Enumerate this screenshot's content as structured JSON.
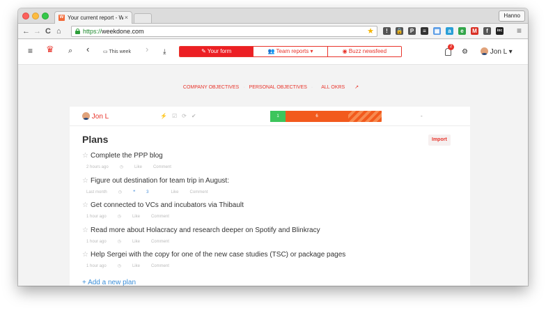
{
  "browser": {
    "tab_title": "Your current report - Weekdone",
    "tab_close": "×",
    "tab_favicon": "W",
    "profile": "Hanno",
    "url_scheme": "https://",
    "url_host": "weekdone.com",
    "nav": {
      "back": "←",
      "forward": "→",
      "reload": "C",
      "home": "⌂"
    },
    "bookmark_star": "★",
    "extensions": [
      {
        "icon": "info-icon",
        "glyph": "!",
        "color": "#555555"
      },
      {
        "icon": "lock-icon",
        "glyph": "🔒",
        "color": "#555555"
      },
      {
        "icon": "pocket-icon",
        "glyph": "P",
        "color": "#555555"
      },
      {
        "icon": "buffer-icon",
        "glyph": "≡",
        "color": "#333333"
      },
      {
        "icon": "calendar-icon",
        "glyph": "▦",
        "color": "#5a9ce6"
      },
      {
        "icon": "amazon-icon",
        "glyph": "a",
        "color": "#2a9fd6"
      },
      {
        "icon": "evernote-icon",
        "glyph": "e",
        "color": "#33a64b"
      },
      {
        "icon": "gmail-icon",
        "glyph": "M",
        "color": "#d93025"
      },
      {
        "icon": "feedly-icon",
        "glyph": "f",
        "color": "#555555"
      },
      {
        "icon": "inc-icon",
        "glyph": "inc",
        "color": "#222222"
      }
    ],
    "menu": "≡"
  },
  "app": {
    "menu_icon": "≡",
    "logo": "♛",
    "search_icon": "⌕",
    "prev": "‹",
    "week_label": "This week",
    "next": "›",
    "download_icon": "⤓",
    "tabs": [
      "Your form",
      "Team reports",
      "Buzz newsfeed"
    ],
    "tab_icons": [
      "✎",
      "👥",
      "◉"
    ],
    "team_caret": "▾",
    "notifications_count": "2",
    "settings_icon": "⚙",
    "user_name": "Jon L",
    "user_caret": "▾",
    "accent": "#e8332a"
  },
  "okr_links": [
    "COMPANY OBJECTIVES",
    "PERSONAL OBJECTIVES",
    "ALL OKRS"
  ],
  "okr_sep": "·",
  "okr_ext_icon": "↗",
  "card": {
    "user": "Jon L",
    "icons": [
      "⚡",
      "☑",
      "⟳",
      "✔"
    ],
    "progress": {
      "green": "1",
      "red": "6"
    },
    "dash": "-",
    "plans_title": "Plans",
    "import_label": "Import",
    "add_label": "+ Add a new plan",
    "like_label": "Like",
    "comment_label": "Comment",
    "clock": "◷",
    "plans": [
      {
        "title": "Complete the PPP blog",
        "time": "2 hours ago",
        "comments": ""
      },
      {
        "title": "Figure out destination for team trip in August:",
        "time": "Last month",
        "comments": "3"
      },
      {
        "title": "Get connected to VCs and incubators via Thibault",
        "time": "1 hour ago",
        "comments": ""
      },
      {
        "title": "Read more about Holacracy and research deeper on Spotify and Blinkracy",
        "time": "1 hour ago",
        "comments": ""
      },
      {
        "title": "Help Sergei with the copy for one of the new case studies (TSC) or package pages",
        "time": "1 hour ago",
        "comments": ""
      }
    ]
  }
}
